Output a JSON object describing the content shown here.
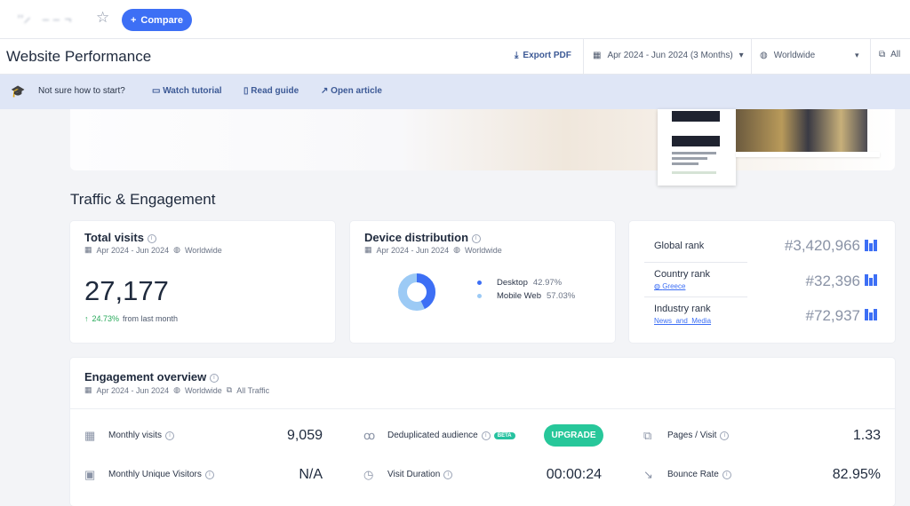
{
  "topbar": {
    "site_name": "′′ ̷    – – ¬",
    "star_icon": "star-icon",
    "compare_label": "Compare",
    "compare_icon": "+"
  },
  "header": {
    "title": "Website Performance",
    "export_label": "Export PDF",
    "date_range": "Apr 2024 - Jun 2024 (3 Months)",
    "region": "Worldwide",
    "filter": "All"
  },
  "banner": {
    "prompt": "Not sure how to start?",
    "watch": "Watch tutorial",
    "read": "Read guide",
    "open": "Open article"
  },
  "section_title": "Traffic & Engagement",
  "total_visits": {
    "title": "Total visits",
    "date": "Apr 2024 - Jun 2024",
    "region": "Worldwide",
    "value": "27,177",
    "change": "24.73%",
    "change_note": "from last month"
  },
  "device_distribution": {
    "title": "Device distribution",
    "date": "Apr 2024 - Jun 2024",
    "region": "Worldwide",
    "desktop_label": "Desktop",
    "desktop_value": "42.97%",
    "desktop_share": 42.97,
    "mobile_label": "Mobile Web",
    "mobile_value": "57.03%",
    "colors": {
      "desktop": "#3d6ff5",
      "mobile": "#9ccaf5"
    }
  },
  "ranks": {
    "global_label": "Global rank",
    "global_value": "#3,420,966",
    "country_label": "Country rank",
    "country_sub": "Greece",
    "country_value": "#32,396",
    "industry_label": "Industry rank",
    "industry_sub": "News_and_Media",
    "industry_value": "#72,937"
  },
  "engagement": {
    "title": "Engagement overview",
    "date": "Apr 2024 - Jun 2024",
    "region": "Worldwide",
    "traffic": "All Traffic",
    "monthly_visits_label": "Monthly visits",
    "monthly_visits_value": "9,059",
    "dedup_label": "Deduplicated audience",
    "beta": "BETA",
    "upgrade": "UPGRADE",
    "pages_visit_label": "Pages / Visit",
    "pages_visit_value": "1.33",
    "unique_label": "Monthly Unique Visitors",
    "unique_value": "N/A",
    "duration_label": "Visit Duration",
    "duration_value": "00:00:24",
    "bounce_label": "Bounce Rate",
    "bounce_value": "82.95%"
  }
}
